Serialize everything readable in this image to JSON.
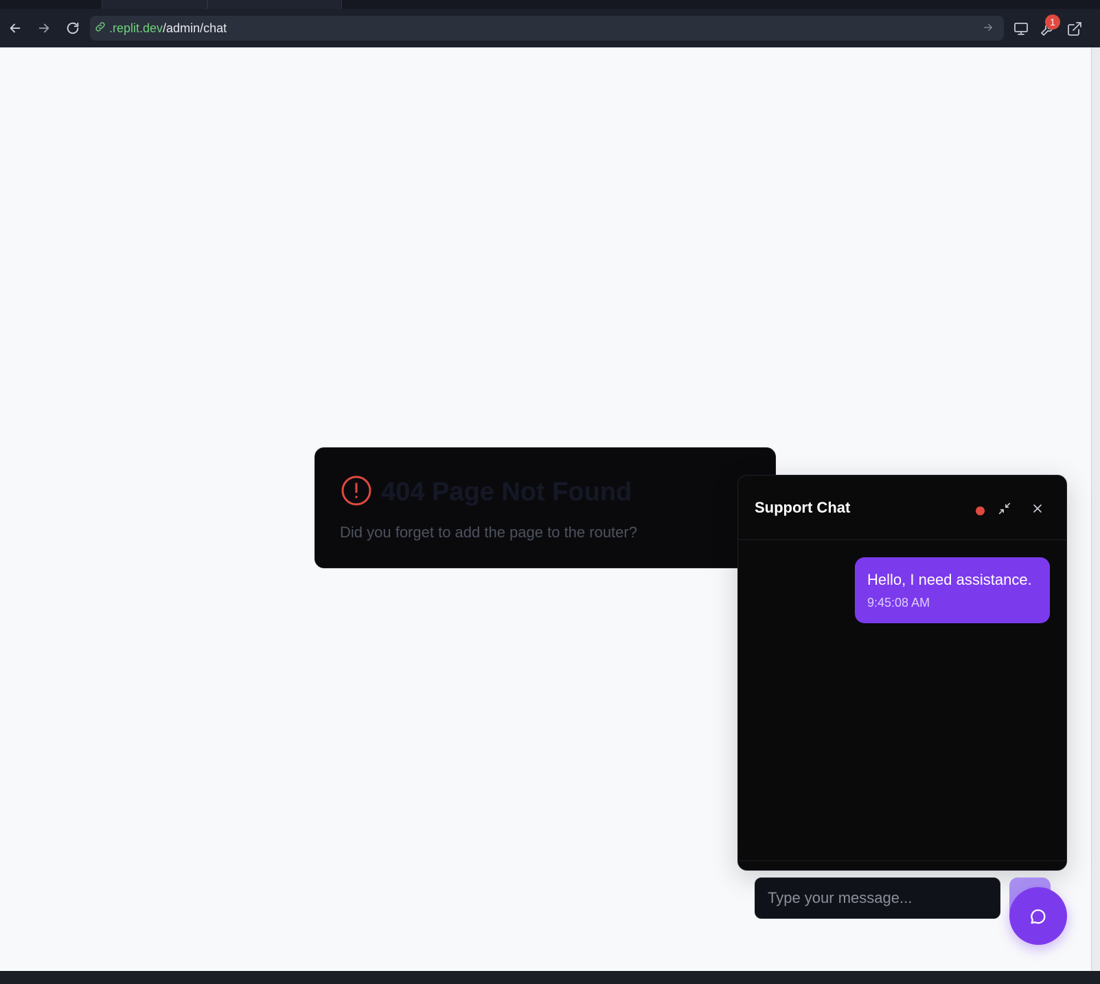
{
  "browser": {
    "url_host": ".replit.dev",
    "url_path": "/admin/chat",
    "devtools_badge_count": "1",
    "icons": {
      "back": "arrow-left-icon",
      "forward": "arrow-right-icon",
      "reload": "reload-icon",
      "link": "link-icon",
      "go": "arrow-right-icon",
      "device": "monitor-icon",
      "devtools": "wrench-icon",
      "external": "external-link-icon"
    }
  },
  "not_found": {
    "title": "404 Page Not Found",
    "description": "Did you forget to add the page to the router?",
    "icon": "alert-circle-icon"
  },
  "chat": {
    "title": "Support Chat",
    "status_color": "#e0493f",
    "messages": [
      {
        "text": "Hello, I need assistance.",
        "time": "9:45:08 AM"
      }
    ],
    "input_placeholder": "Type your message...",
    "accent_color": "#7c3aed"
  }
}
